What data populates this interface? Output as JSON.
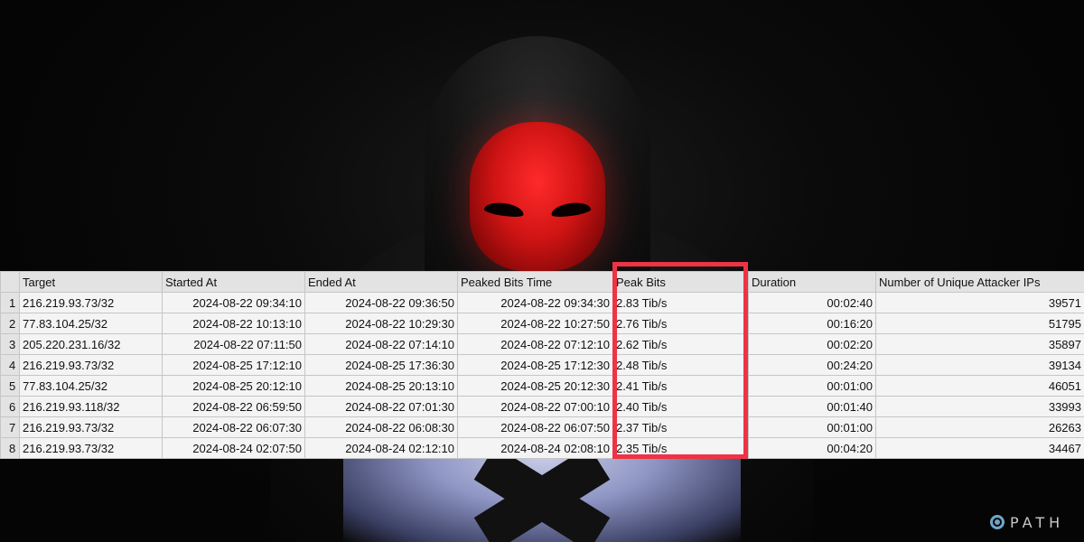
{
  "table": {
    "columns": [
      "Target",
      "Started At",
      "Ended At",
      "Peaked Bits Time",
      "Peak Bits",
      "Duration",
      "Number of Unique Attacker IPs"
    ],
    "rows": [
      {
        "n": "1",
        "target": "216.219.93.73/32",
        "started": "2024-08-22 09:34:10",
        "ended": "2024-08-22 09:36:50",
        "peak_time": "2024-08-22 09:34:30",
        "peak_bits": "2.83 Tib/s",
        "duration": "00:02:40",
        "ips": "39571"
      },
      {
        "n": "2",
        "target": "77.83.104.25/32",
        "started": "2024-08-22 10:13:10",
        "ended": "2024-08-22 10:29:30",
        "peak_time": "2024-08-22 10:27:50",
        "peak_bits": "2.76 Tib/s",
        "duration": "00:16:20",
        "ips": "51795"
      },
      {
        "n": "3",
        "target": "205.220.231.16/32",
        "started": "2024-08-22 07:11:50",
        "ended": "2024-08-22 07:14:10",
        "peak_time": "2024-08-22 07:12:10",
        "peak_bits": "2.62 Tib/s",
        "duration": "00:02:20",
        "ips": "35897"
      },
      {
        "n": "4",
        "target": "216.219.93.73/32",
        "started": "2024-08-25 17:12:10",
        "ended": "2024-08-25 17:36:30",
        "peak_time": "2024-08-25 17:12:30",
        "peak_bits": "2.48 Tib/s",
        "duration": "00:24:20",
        "ips": "39134"
      },
      {
        "n": "5",
        "target": "77.83.104.25/32",
        "started": "2024-08-25 20:12:10",
        "ended": "2024-08-25 20:13:10",
        "peak_time": "2024-08-25 20:12:30",
        "peak_bits": "2.41 Tib/s",
        "duration": "00:01:00",
        "ips": "46051"
      },
      {
        "n": "6",
        "target": "216.219.93.118/32",
        "started": "2024-08-22 06:59:50",
        "ended": "2024-08-22 07:01:30",
        "peak_time": "2024-08-22 07:00:10",
        "peak_bits": "2.40 Tib/s",
        "duration": "00:01:40",
        "ips": "33993"
      },
      {
        "n": "7",
        "target": "216.219.93.73/32",
        "started": "2024-08-22 06:07:30",
        "ended": "2024-08-22 06:08:30",
        "peak_time": "2024-08-22 06:07:50",
        "peak_bits": "2.37 Tib/s",
        "duration": "00:01:00",
        "ips": "26263"
      },
      {
        "n": "8",
        "target": "216.219.93.73/32",
        "started": "2024-08-24 02:07:50",
        "ended": "2024-08-24 02:12:10",
        "peak_time": "2024-08-24 02:08:10",
        "peak_bits": "2.35 Tib/s",
        "duration": "00:04:20",
        "ips": "34467"
      }
    ]
  },
  "highlight": {
    "column": "Peak Bits",
    "color": "#ee3344"
  },
  "logo": {
    "text": "PATH",
    "icon": "path-logo-icon"
  },
  "colors": {
    "mask": "#d11414",
    "background": "#050505"
  }
}
